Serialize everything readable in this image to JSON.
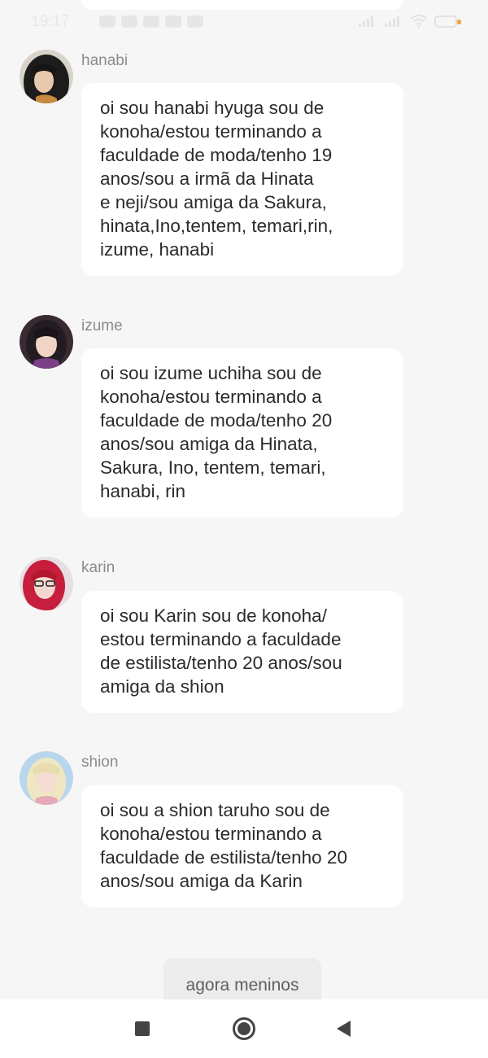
{
  "status_bar": {
    "time": "19:17"
  },
  "messages": [
    {
      "sender": "hanabi",
      "text": "oi sou hanabi hyuga sou de\nkonoha/estou terminando a\nfaculdade de moda/tenho 19\nanos/sou a irmã da Hinata\ne neji/sou amiga da Sakura,\nhinata,Ino,tentem, temari,rin,\nizume, hanabi"
    },
    {
      "sender": "izume",
      "text": "oi sou izume uchiha sou de\nkonoha/estou terminando a\nfaculdade de moda/tenho 20\nanos/sou amiga da Hinata,\nSakura, Ino, tentem, temari,\nhanabi, rin"
    },
    {
      "sender": "karin",
      "text": "oi sou Karin sou de konoha/\nestou terminando a faculdade\nde estilista/tenho 20 anos/sou\namiga da shion"
    },
    {
      "sender": "shion",
      "text": "oi sou a shion taruho sou de\nkonoha/estou terminando a\nfaculdade de estilista/tenho 20\nanos/sou amiga da Karin"
    }
  ],
  "draft": {
    "text": "agora meninos"
  },
  "nav": {
    "recents_icon": "square-icon",
    "home_icon": "circle-icon",
    "back_icon": "triangle-back-icon"
  },
  "colors": {
    "background": "#f6f6f6",
    "bubble": "#ffffff",
    "draft_bubble": "#ececec",
    "sender_name": "#8b8b8b",
    "battery_accent": "#f3a93c"
  }
}
